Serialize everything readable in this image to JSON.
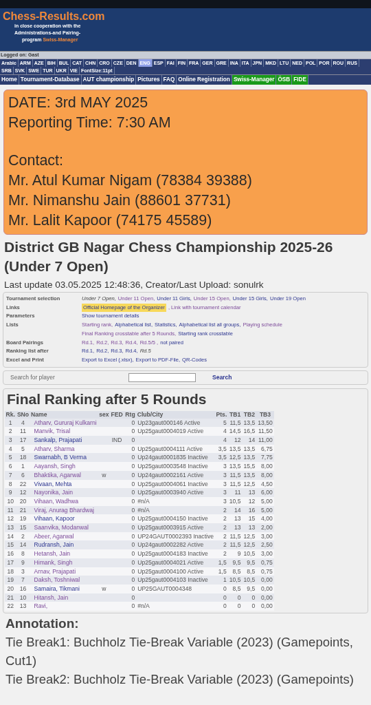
{
  "header": {
    "logo": "Chess-Results.com",
    "tagline_lines": [
      "in close cooperation with the",
      "Administrations-and Pairing-"
    ],
    "tagline_last": "program",
    "tagline_brand": "Swiss-Manager"
  },
  "login": "Logged on: Gast",
  "languages": [
    {
      "label": "Arabic",
      "selected": false
    },
    {
      "label": "ARM",
      "selected": false
    },
    {
      "label": "AZE",
      "selected": false
    },
    {
      "label": "BIH",
      "selected": false
    },
    {
      "label": "BUL",
      "selected": false
    },
    {
      "label": "CAT",
      "selected": false
    },
    {
      "label": "CHN",
      "selected": false
    },
    {
      "label": "CRO",
      "selected": false
    },
    {
      "label": "CZE",
      "selected": false
    },
    {
      "label": "DEN",
      "selected": false
    },
    {
      "label": "ENG",
      "selected": true
    },
    {
      "label": "ESP",
      "selected": false
    },
    {
      "label": "FAI",
      "selected": false
    },
    {
      "label": "FIN",
      "selected": false
    },
    {
      "label": "FRA",
      "selected": false
    },
    {
      "label": "GER",
      "selected": false
    },
    {
      "label": "GRE",
      "selected": false
    },
    {
      "label": "INA",
      "selected": false
    },
    {
      "label": "ITA",
      "selected": false
    },
    {
      "label": "JPN",
      "selected": false
    },
    {
      "label": "MKD",
      "selected": false
    },
    {
      "label": "LTU",
      "selected": false
    },
    {
      "label": "NED",
      "selected": false
    },
    {
      "label": "POL",
      "selected": false
    },
    {
      "label": "POR",
      "selected": false
    },
    {
      "label": "ROU",
      "selected": false
    },
    {
      "label": "RUS",
      "selected": false
    },
    {
      "label": "SRB",
      "selected": false
    },
    {
      "label": "SVK",
      "selected": false
    },
    {
      "label": "SWE",
      "selected": false
    },
    {
      "label": "TUR",
      "selected": false
    },
    {
      "label": "UKR",
      "selected": false
    },
    {
      "label": "VIE",
      "selected": false
    }
  ],
  "font_size": "FontSize:11pt",
  "nav": [
    {
      "label": "Home",
      "kind": "main"
    },
    {
      "label": "Tournament-Database",
      "kind": "main"
    },
    {
      "label": "AUT championship",
      "kind": "main"
    },
    {
      "label": "Pictures",
      "kind": "main"
    },
    {
      "label": "FAQ",
      "kind": "main"
    },
    {
      "label": "Online Registration",
      "kind": "main"
    },
    {
      "label": "Swiss-Manager",
      "kind": "partner"
    },
    {
      "label": "ÖSB",
      "kind": "partner"
    },
    {
      "label": "FIDE",
      "kind": "partner"
    }
  ],
  "notice": {
    "lines": [
      "DATE: 3rd MAY 2025",
      "Reporting Time: 7:30 AM"
    ],
    "contact_title": "Contact:",
    "contacts": [
      "Mr. Atul Kumar Nigam (78384 39388)",
      "Mr. Nimanshu Jain (88601 37731)",
      "Mr. Lalit Kapoor (74175 45589)"
    ]
  },
  "title": "District GB Nagar Chess Championship 2025-26 (Under 7 Open)",
  "last_update": "Last update 03.05.2025 12:48:36, Creator/Last Upload: sonulrk",
  "info": [
    {
      "label": "Tournament selection",
      "lines": [
        [
          {
            "text": "Under 7 Open,",
            "kind": "current"
          },
          {
            "text": "Under 11 Open,",
            "kind": "link",
            "visited": true
          },
          {
            "text": "Under 11 Girls,",
            "kind": "link",
            "visited": false
          },
          {
            "text": "Under 15 Open,",
            "kind": "link",
            "visited": true
          },
          {
            "text": "Under 15 Girls,",
            "kind": "link",
            "visited": false
          },
          {
            "text": "Under 19 Open",
            "kind": "link",
            "visited": false
          }
        ]
      ]
    },
    {
      "label": "Links",
      "lines": [
        [
          {
            "text": "Official Homepage of the Organizer",
            "kind": "highlight"
          },
          {
            "text": ", Link with tournament calendar",
            "kind": "link",
            "visited": true
          }
        ]
      ]
    },
    {
      "label": "Parameters",
      "lines": [
        [
          {
            "text": "Show tournament details",
            "kind": "link",
            "visited": false
          }
        ]
      ]
    },
    {
      "label": "Lists",
      "lines": [
        [
          {
            "text": "Starting rank,",
            "kind": "link",
            "visited": true
          },
          {
            "text": "Alphabetical list,",
            "kind": "link",
            "visited": false
          },
          {
            "text": "Statistics,",
            "kind": "link",
            "visited": false
          },
          {
            "text": "Alphabetical list all groups,",
            "kind": "link",
            "visited": false
          },
          {
            "text": "Playing schedule",
            "kind": "link",
            "visited": true
          }
        ],
        [
          {
            "text": "Final Ranking crosstable after 5 Rounds,",
            "kind": "link",
            "visited": true
          },
          {
            "text": "Starting rank crosstable",
            "kind": "link",
            "visited": false
          }
        ]
      ]
    },
    {
      "label": "Board Pairings",
      "lines": [
        [
          {
            "text": "Rd.1,",
            "kind": "link",
            "visited": true
          },
          {
            "text": "Rd.2,",
            "kind": "link",
            "visited": true
          },
          {
            "text": "Rd.3,",
            "kind": "link",
            "visited": true
          },
          {
            "text": "Rd.4,",
            "kind": "link",
            "visited": true
          },
          {
            "text": "Rd.5/5 ,",
            "kind": "link",
            "visited": true
          },
          {
            "text": "not paired",
            "kind": "link",
            "visited": false
          }
        ]
      ]
    },
    {
      "label": "Ranking list after",
      "lines": [
        [
          {
            "text": "Rd.1,",
            "kind": "link",
            "visited": false
          },
          {
            "text": "Rd.2,",
            "kind": "link",
            "visited": false
          },
          {
            "text": "Rd.3,",
            "kind": "link",
            "visited": false
          },
          {
            "text": "Rd.4,",
            "kind": "link",
            "visited": false
          },
          {
            "text": "Rd.5",
            "kind": "current"
          }
        ]
      ]
    },
    {
      "label": "Excel and Print",
      "lines": [
        [
          {
            "text": "Export to Excel (.xlsx),",
            "kind": "link",
            "visited": false
          },
          {
            "text": "Export to PDF-File,",
            "kind": "link",
            "visited": false
          },
          {
            "text": "QR-Codes",
            "kind": "link",
            "visited": false
          }
        ]
      ]
    }
  ],
  "search": {
    "label": "Search for player",
    "button": "Search"
  },
  "ranking": {
    "title": "Final Ranking after 5 Rounds",
    "columns": [
      "Rk.",
      "SNo",
      "Name",
      "sex",
      "FED",
      "Rtg",
      "Club/City",
      "Pts.",
      "TB1",
      "TB2",
      "TB3"
    ],
    "rows": [
      {
        "rk": "1",
        "sno": "4",
        "name": "Atharv, Gururaj Kulkarni",
        "visited": true,
        "sex": "",
        "fed": "",
        "rtg": "0",
        "club": "Up23gaut000146 Active",
        "pts": "5",
        "tb1": "11,5",
        "tb2": "13,5",
        "tb3": "13,50"
      },
      {
        "rk": "2",
        "sno": "11",
        "name": "Manvik, Trisal",
        "visited": true,
        "sex": "",
        "fed": "",
        "rtg": "0",
        "club": "Up25gaut0004019 Active",
        "pts": "4",
        "tb1": "14,5",
        "tb2": "16,5",
        "tb3": "11,50"
      },
      {
        "rk": "3",
        "sno": "17",
        "name": "Sankalp, Prajapati",
        "visited": false,
        "sex": "",
        "fed": "IND",
        "rtg": "0",
        "club": "",
        "pts": "4",
        "tb1": "12",
        "tb2": "14",
        "tb3": "11,00"
      },
      {
        "rk": "4",
        "sno": "5",
        "name": "Atharv, Sharma",
        "visited": true,
        "sex": "",
        "fed": "",
        "rtg": "0",
        "club": "Up25gaut0004111 Active",
        "pts": "3,5",
        "tb1": "13,5",
        "tb2": "13,5",
        "tb3": "6,75"
      },
      {
        "rk": "5",
        "sno": "18",
        "name": "Swarnabh, B Verma",
        "visited": false,
        "sex": "",
        "fed": "",
        "rtg": "0",
        "club": "Up24gaut0001835 Inactive",
        "pts": "3,5",
        "tb1": "12,5",
        "tb2": "13,5",
        "tb3": "7,75"
      },
      {
        "rk": "6",
        "sno": "1",
        "name": "Aayansh, Singh",
        "visited": true,
        "sex": "",
        "fed": "",
        "rtg": "0",
        "club": "Up25gaut0003548 Inactive",
        "pts": "3",
        "tb1": "13,5",
        "tb2": "15,5",
        "tb3": "8,00"
      },
      {
        "rk": "7",
        "sno": "6",
        "name": "Bhaktika, Agarwal",
        "visited": true,
        "sex": "w",
        "fed": "",
        "rtg": "0",
        "club": "Up24gaut0002161 Active",
        "pts": "3",
        "tb1": "11,5",
        "tb2": "13,5",
        "tb3": "8,00"
      },
      {
        "rk": "8",
        "sno": "22",
        "name": "Vivaan, Mehta",
        "visited": false,
        "sex": "",
        "fed": "",
        "rtg": "0",
        "club": "Up25gaut0004061 Inactive",
        "pts": "3",
        "tb1": "11,5",
        "tb2": "12,5",
        "tb3": "4,50"
      },
      {
        "rk": "9",
        "sno": "12",
        "name": "Nayonika, Jain",
        "visited": true,
        "sex": "",
        "fed": "",
        "rtg": "0",
        "club": "Up25gaut0003940 Active",
        "pts": "3",
        "tb1": "11",
        "tb2": "13",
        "tb3": "6,00"
      },
      {
        "rk": "10",
        "sno": "20",
        "name": "Vihaan, Wadhwa",
        "visited": true,
        "sex": "",
        "fed": "",
        "rtg": "0",
        "club": "#n/A",
        "pts": "3",
        "tb1": "10,5",
        "tb2": "12",
        "tb3": "5,00"
      },
      {
        "rk": "11",
        "sno": "21",
        "name": "Viraj, Anurag Bhardwaj",
        "visited": true,
        "sex": "",
        "fed": "",
        "rtg": "0",
        "club": "#n/A",
        "pts": "2",
        "tb1": "14",
        "tb2": "16",
        "tb3": "5,00"
      },
      {
        "rk": "12",
        "sno": "19",
        "name": "Vihaan, Kapoor",
        "visited": false,
        "sex": "",
        "fed": "",
        "rtg": "0",
        "club": "Up25gaut0004150 Inactive",
        "pts": "2",
        "tb1": "13",
        "tb2": "15",
        "tb3": "4,00"
      },
      {
        "rk": "13",
        "sno": "15",
        "name": "Saanvika, Modanwal",
        "visited": true,
        "sex": "",
        "fed": "",
        "rtg": "0",
        "club": "Up25gaut0003915 Active",
        "pts": "2",
        "tb1": "13",
        "tb2": "13",
        "tb3": "2,00"
      },
      {
        "rk": "14",
        "sno": "2",
        "name": "Abeer, Agarwal",
        "visited": true,
        "sex": "",
        "fed": "",
        "rtg": "0",
        "club": "UP24GAUT0002393 Inactive",
        "pts": "2",
        "tb1": "11,5",
        "tb2": "12,5",
        "tb3": "3,00"
      },
      {
        "rk": "15",
        "sno": "14",
        "name": "Rudransh, Jain",
        "visited": false,
        "sex": "",
        "fed": "",
        "rtg": "0",
        "club": "Up24gaut0002282 Active",
        "pts": "2",
        "tb1": "11,5",
        "tb2": "12,5",
        "tb3": "2,50"
      },
      {
        "rk": "16",
        "sno": "8",
        "name": "Hetansh, Jain",
        "visited": true,
        "sex": "",
        "fed": "",
        "rtg": "0",
        "club": "Up25gaut0004183 Inactive",
        "pts": "2",
        "tb1": "9",
        "tb2": "10,5",
        "tb3": "3,00"
      },
      {
        "rk": "17",
        "sno": "9",
        "name": "Himank, Singh",
        "visited": true,
        "sex": "",
        "fed": "",
        "rtg": "0",
        "club": "Up25gaut0004021 Active",
        "pts": "1,5",
        "tb1": "9,5",
        "tb2": "9,5",
        "tb3": "0,75"
      },
      {
        "rk": "18",
        "sno": "3",
        "name": "Arnav, Prajapati",
        "visited": true,
        "sex": "",
        "fed": "",
        "rtg": "0",
        "club": "Up25gaut0004100 Active",
        "pts": "1,5",
        "tb1": "8,5",
        "tb2": "8,5",
        "tb3": "0,75"
      },
      {
        "rk": "19",
        "sno": "7",
        "name": "Daksh, Toshniwal",
        "visited": true,
        "sex": "",
        "fed": "",
        "rtg": "0",
        "club": "Up25gaut0004103 Inactive",
        "pts": "1",
        "tb1": "10,5",
        "tb2": "10,5",
        "tb3": "0,00"
      },
      {
        "rk": "20",
        "sno": "16",
        "name": "Samaira, Tikmani",
        "visited": false,
        "sex": "w",
        "fed": "",
        "rtg": "0",
        "club": "UP25GAUT0004348",
        "pts": "0",
        "tb1": "8,5",
        "tb2": "9,5",
        "tb3": "0,00"
      },
      {
        "rk": "21",
        "sno": "10",
        "name": "Hitansh, Jain",
        "visited": true,
        "sex": "",
        "fed": "",
        "rtg": "0",
        "club": "",
        "pts": "0",
        "tb1": "0",
        "tb2": "0",
        "tb3": "0,00"
      },
      {
        "rk": "22",
        "sno": "13",
        "name": "Ravi,",
        "visited": true,
        "sex": "",
        "fed": "",
        "rtg": "0",
        "club": "#n/A",
        "pts": "0",
        "tb1": "0",
        "tb2": "0",
        "tb3": "0,00"
      }
    ]
  },
  "annotation": {
    "title": "Annotation:",
    "lines": [
      "Tie Break1: Buchholz Tie-Break Variable (2023) (Gamepoints, Cut1)",
      "Tie Break2: Buchholz Tie-Break Variable (2023) (Gamepoints)"
    ]
  }
}
